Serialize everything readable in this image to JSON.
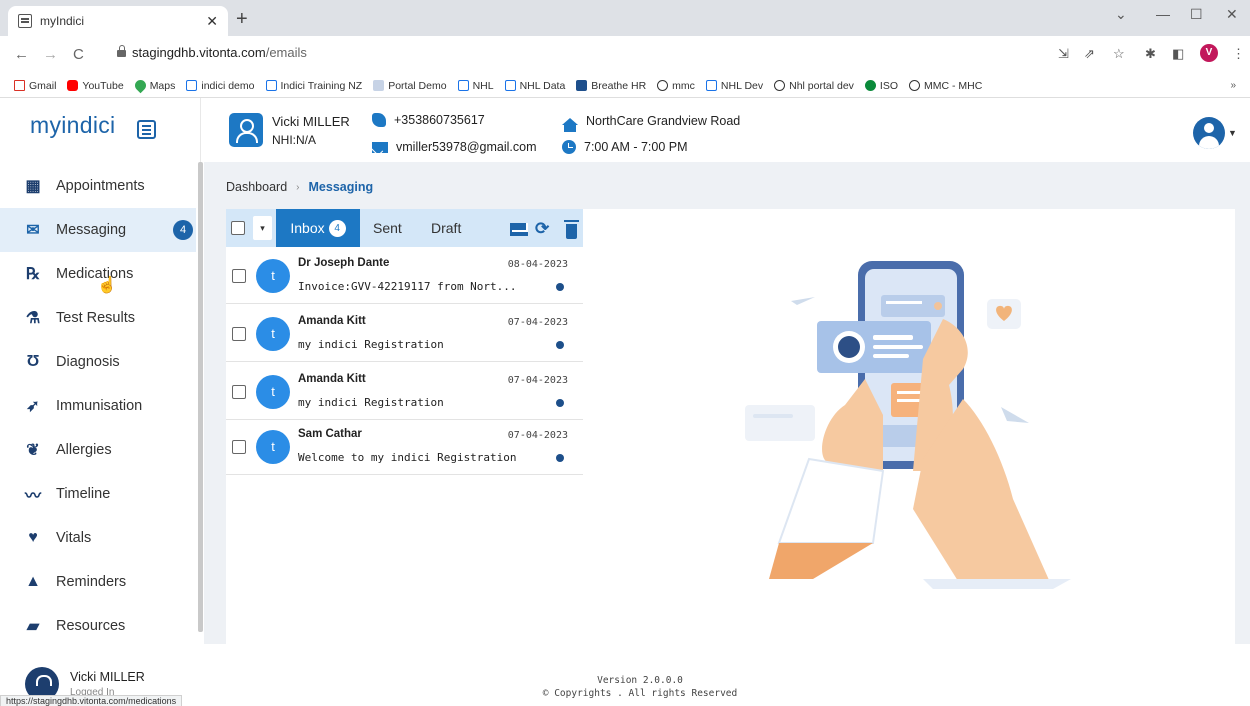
{
  "browser": {
    "tab_title": "myIndici",
    "url_host": "stagingdhb.vitonta.com",
    "url_path": "/emails",
    "profile_initial": "V",
    "bookmarks": [
      "Gmail",
      "YouTube",
      "Maps",
      "indici demo",
      "Indici Training NZ",
      "Portal Demo",
      "NHL",
      "NHL Data",
      "Breathe HR",
      "mmc",
      "NHL Dev",
      "Nhl portal dev",
      "ISO",
      "MMC - MHC"
    ],
    "status_url": "https://stagingdhb.vitonta.com/medications"
  },
  "header": {
    "logo_text": "myindici",
    "patient_name": "Vicki MILLER",
    "patient_nhi": "NHI:N/A",
    "phone": "+353860735617",
    "email": "vmiller53978@gmail.com",
    "practice": "NorthCare Grandview Road",
    "hours": "7:00 AM - 7:00 PM"
  },
  "sidebar": {
    "items": [
      {
        "label": "Appointments",
        "icon": "calendar-icon"
      },
      {
        "label": "Messaging",
        "icon": "envelope-icon",
        "badge": "4",
        "active": true
      },
      {
        "label": "Medications",
        "icon": "rx-icon"
      },
      {
        "label": "Test Results",
        "icon": "flask-icon"
      },
      {
        "label": "Diagnosis",
        "icon": "stethoscope-icon"
      },
      {
        "label": "Immunisation",
        "icon": "syringe-icon"
      },
      {
        "label": "Allergies",
        "icon": "allergy-icon"
      },
      {
        "label": "Timeline",
        "icon": "timeline-icon"
      },
      {
        "label": "Vitals",
        "icon": "heartbeat-icon"
      },
      {
        "label": "Reminders",
        "icon": "bell-icon"
      },
      {
        "label": "Resources",
        "icon": "folder-icon"
      }
    ]
  },
  "breadcrumb": {
    "home": "Dashboard",
    "current": "Messaging"
  },
  "mail": {
    "tabs": {
      "inbox": "Inbox",
      "inbox_count": "4",
      "sent": "Sent",
      "draft": "Draft"
    },
    "messages": [
      {
        "avatar": "t",
        "sender": "Dr Joseph Dante",
        "subject": "Invoice:GVV-42219117 from Nort...",
        "date": "08-04-2023"
      },
      {
        "avatar": "t",
        "sender": "Amanda Kitt",
        "subject": "my indici Registration",
        "date": "07-04-2023"
      },
      {
        "avatar": "t",
        "sender": "Amanda Kitt",
        "subject": "my indici Registration",
        "date": "07-04-2023"
      },
      {
        "avatar": "t",
        "sender": "Sam Cathar",
        "subject": "Welcome to my indici Registration",
        "date": "07-04-2023"
      }
    ]
  },
  "footer": {
    "user_name": "Vicki MILLER",
    "user_sub": "Logged In",
    "version": "Version 2.0.0.0",
    "copyright": "© Copyrights . All rights Reserved"
  },
  "colors": {
    "primary": "#1d64a9",
    "accent": "#1d78c4",
    "active_bg": "#e3eef9",
    "toolbar_bg": "#d4e7f8"
  }
}
